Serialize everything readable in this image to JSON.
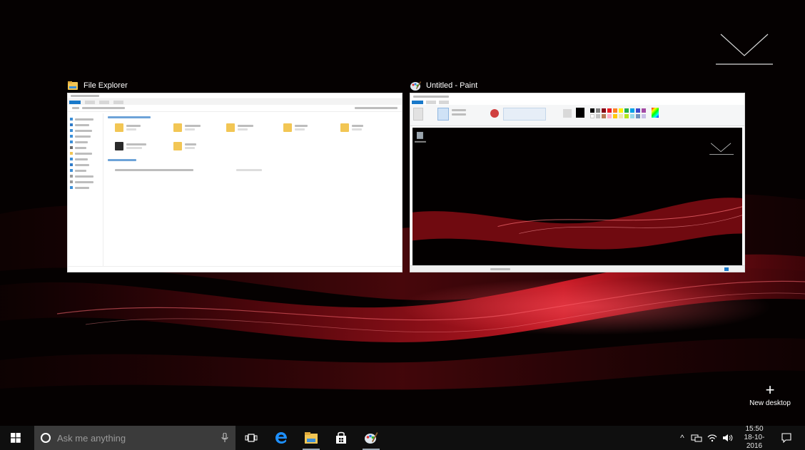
{
  "colors": {
    "wallpaper_bg": "#050101",
    "wave_red": "#c0101c",
    "taskbar_bg": "#0f0f0f",
    "search_bg": "#3b3b3b",
    "accent_blue": "#1979ca",
    "edge_blue": "#1e90ff"
  },
  "task_view": {
    "windows": [
      {
        "title": "File Explorer",
        "icon": "folder-icon"
      },
      {
        "title": "Untitled - Paint",
        "icon": "paint-icon"
      }
    ],
    "new_desktop": {
      "icon": "plus-icon",
      "label": "New desktop"
    }
  },
  "taskbar": {
    "start_icon": "windows-start-icon",
    "search": {
      "icon": "cortana-circle-icon",
      "placeholder": "Ask me anything",
      "mic_icon": "microphone-icon"
    },
    "pinned": [
      {
        "name": "task-view-icon"
      },
      {
        "name": "edge-icon"
      },
      {
        "name": "file-explorer-icon"
      },
      {
        "name": "store-icon"
      },
      {
        "name": "paint-icon"
      }
    ],
    "tray": {
      "chevron": "^",
      "icons": [
        "network-icon",
        "wifi-icon",
        "volume-icon"
      ],
      "time": "15:50",
      "date": "18-10-2016",
      "notification_icon": "action-center-icon"
    }
  }
}
